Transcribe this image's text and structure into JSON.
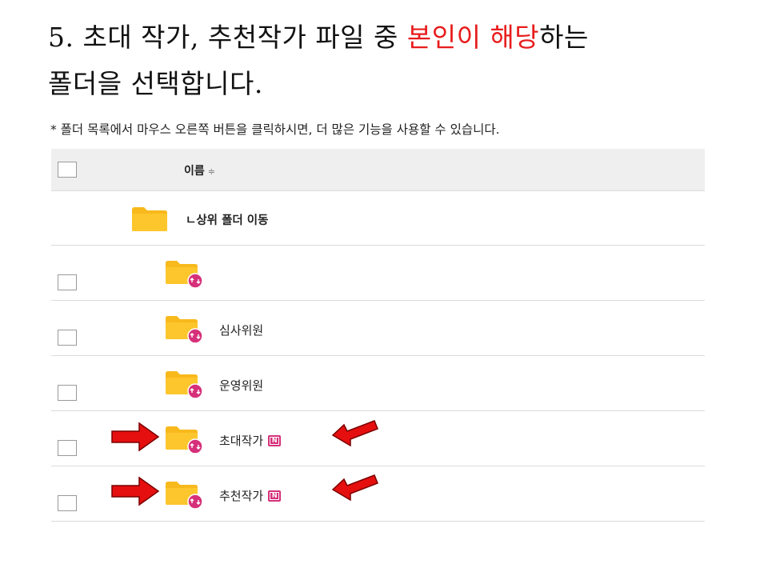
{
  "heading": {
    "part1": "5. 초대 작가, 추천작가 파일 중 ",
    "highlight": "본인이 해당",
    "part2": "하는",
    "line2": "폴더을 선택합니다."
  },
  "note": "* 폴더 목록에서 마우스 오른쪽 버튼을 클릭하시면, 더 많은 기능을 사용할 수 있습니다.",
  "table": {
    "header_name": "이름",
    "sort_symbol": "≑",
    "up_folder_label": "ㄴ상위 폴더 이동",
    "rows": [
      {
        "name": "",
        "new_badge": false
      },
      {
        "name": "심사위원",
        "new_badge": false
      },
      {
        "name": "운영위원",
        "new_badge": false
      },
      {
        "name": "초대작가",
        "new_badge": true
      },
      {
        "name": "추천작가",
        "new_badge": true
      }
    ],
    "badge_text": "N"
  },
  "colors": {
    "highlight": "#e81c1c",
    "folder": "#f8b91c",
    "share_badge": "#d6307a",
    "arrow": "#e60f0f"
  },
  "icons": [
    "folder-icon",
    "shared-folder-icon",
    "new-badge-icon",
    "red-arrow-icon"
  ]
}
